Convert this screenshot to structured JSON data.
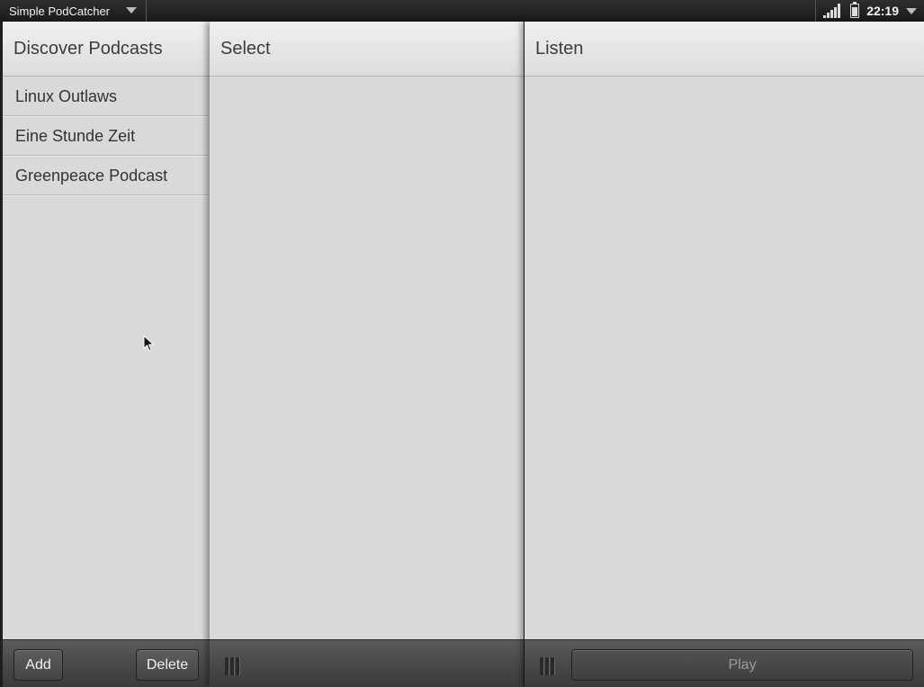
{
  "statusbar": {
    "app_title": "Simple PodCatcher",
    "time": "22:19"
  },
  "left": {
    "header": "Discover Podcasts",
    "podcasts": [
      {
        "label": "Linux Outlaws"
      },
      {
        "label": "Eine Stunde Zeit"
      },
      {
        "label": "Greenpeace Podcast"
      }
    ],
    "add_label": "Add",
    "delete_label": "Delete"
  },
  "middle": {
    "header": "Select"
  },
  "right": {
    "header": "Listen",
    "play_label": "Play"
  }
}
